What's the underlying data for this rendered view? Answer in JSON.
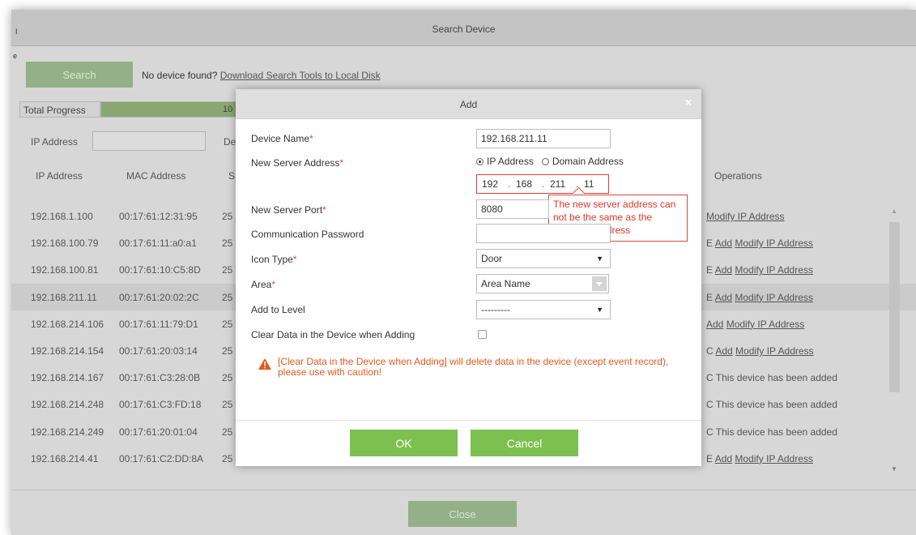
{
  "outer": {
    "title": "Search Device",
    "left_marks": [
      "I",
      "e"
    ],
    "search_label": "Search",
    "no_device_text": "No device found?",
    "download_link": "Download Search Tools to Local Disk",
    "total_progress_label": "Total Progress",
    "progress_value_text": "10",
    "progress_fraction": 1.0,
    "ip_filter_label": "IP Address",
    "filter2_label": "De",
    "columns": {
      "ip": "IP Address",
      "mac": "MAC Address",
      "col3": "S",
      "operations": "Operations"
    },
    "rows": [
      {
        "ip": "192.168.1.100",
        "mac": "00:17:61:12:31:95",
        "col3": "25",
        "op_prefix": "",
        "op_add": "",
        "op_link": "Modify IP Address",
        "op_status": "",
        "highlight": false
      },
      {
        "ip": "192.168.100.79",
        "mac": "00:17:61:11:a0:a1",
        "col3": "25",
        "op_prefix": "E",
        "op_add": "Add",
        "op_link": "Modify IP Address",
        "op_status": "",
        "highlight": false
      },
      {
        "ip": "192.168.100.81",
        "mac": "00:17:61:10:C5:8D",
        "col3": "25",
        "op_prefix": "E",
        "op_add": "Add",
        "op_link": "Modify IP Address",
        "op_status": "",
        "highlight": false
      },
      {
        "ip": "192.168.211.11",
        "mac": "00:17:61:20:02:2C",
        "col3": "25",
        "op_prefix": "E",
        "op_add": "Add",
        "op_link": "Modify IP Address",
        "op_status": "",
        "highlight": true
      },
      {
        "ip": "192.168.214.106",
        "mac": "00:17:61:11:79:D1",
        "col3": "25",
        "op_prefix": "",
        "op_add": "Add",
        "op_link": "Modify IP Address",
        "op_status": "",
        "highlight": false
      },
      {
        "ip": "192.168.214.154",
        "mac": "00:17:61:20:03:14",
        "col3": "25",
        "op_prefix": "C",
        "op_add": "Add",
        "op_link": "Modify IP Address",
        "op_status": "",
        "highlight": false
      },
      {
        "ip": "192.168.214.167",
        "mac": "00:17:61:C3:28:0B",
        "col3": "25",
        "op_prefix": "C",
        "op_add": "",
        "op_link": "",
        "op_status": "This device has been added",
        "highlight": false
      },
      {
        "ip": "192.168.214.248",
        "mac": "00:17:61:C3:FD:18",
        "col3": "25",
        "op_prefix": "C",
        "op_add": "",
        "op_link": "",
        "op_status": "This device has been added",
        "highlight": false
      },
      {
        "ip": "192.168.214.249",
        "mac": "00:17:61:20:01:04",
        "col3": "25",
        "op_prefix": "C",
        "op_add": "",
        "op_link": "",
        "op_status": "This device has been added",
        "highlight": false
      },
      {
        "ip": "192.168.214.41",
        "mac": "00:17:61:C2:DD:8A",
        "col3": "25",
        "op_prefix": "E",
        "op_add": "Add",
        "op_link": "Modify IP Address",
        "op_status": "",
        "highlight": false
      }
    ],
    "close_label": "Close"
  },
  "dialog": {
    "title": "Add",
    "close_icon": "×",
    "device_name_label": "Device Name",
    "device_name_value": "192.168.211.11",
    "server_address_label": "New Server Address",
    "radio_ip_label": "IP Address",
    "radio_domain_label": "Domain Address",
    "ip_segments": [
      "192",
      "168",
      "211",
      "11"
    ],
    "error_tip": "The new server address can not be the same as the device IP address",
    "server_port_label": "New Server Port",
    "server_port_value": "8080",
    "comm_password_label": "Communication Password",
    "comm_password_value": "",
    "icon_type_label": "Icon Type",
    "icon_type_value": "Door",
    "area_label": "Area",
    "area_value": "Area Name",
    "level_label": "Add to Level",
    "level_value": "---------",
    "clear_data_label": "Clear Data in the Device when Adding",
    "warning_text": "[Clear Data in the Device when Adding] will delete data in the device (except event record), please use with caution!",
    "ok_label": "OK",
    "cancel_label": "Cancel",
    "required_mark": "*"
  },
  "colors": {
    "accent_green": "#7cc04f",
    "error_red": "#e13627",
    "warning_orange": "#e25a1e"
  }
}
